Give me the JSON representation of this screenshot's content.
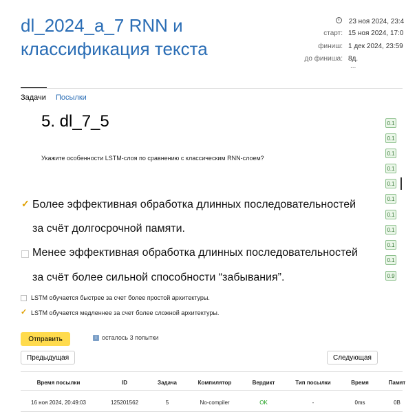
{
  "contest": {
    "title": "dl_2024_a_7 RNN и классификация текста",
    "time_now": "23 ноя 2024, 23:4",
    "start_label": "старт:",
    "start_value": "15 ноя 2024, 17:0",
    "finish_label": "финиш:",
    "finish_value": "1 дек 2024, 23:59",
    "until_label": "до финиша:",
    "until_value": "8д.",
    "more": "..."
  },
  "tabs": [
    {
      "label": "Задачи",
      "active": true
    },
    {
      "label": "Посылки",
      "active": false
    }
  ],
  "task": {
    "title": "5. dl_7_5",
    "question": "Укажите особенности LSTM-слоя по сравнению с классическим RNN-слоем?"
  },
  "options": [
    {
      "line1": "Более эффективная обработка длинных последовательностей",
      "line2": "за счёт долгосрочной памяти.",
      "checked": true
    },
    {
      "line1": "Менее эффективная обработка длинных последовательностей",
      "line2": "за счёт более сильной способности “забывания”.",
      "checked": false
    },
    {
      "line1": "LSTM обучается быстрее за счет более простой архитектуры.",
      "checked": false
    },
    {
      "line1": "LSTM обучается медленнее за счет более сложной архитектуры.",
      "checked": true
    }
  ],
  "scores": [
    "0.1",
    "0.1",
    "0.1",
    "0.1",
    "0.1",
    "0.1",
    "0.1",
    "0.1",
    "0.1",
    "0.1",
    "0.9"
  ],
  "actions": {
    "submit": "Отправить",
    "attempts": "осталось 3 попытки",
    "prev": "Предыдущая",
    "next": "Следующая"
  },
  "table": {
    "headers": [
      "Время посылки",
      "ID",
      "Задача",
      "Компилятор",
      "Вердикт",
      "Тип посылки",
      "Время",
      "Памят"
    ],
    "rows": [
      [
        "16 ноя 2024, 20:49:03",
        "125201562",
        "5",
        "No-compiler",
        "OK",
        "-",
        "0ms",
        "0B"
      ]
    ]
  },
  "colors": {
    "accent": "#2a6db5",
    "submit": "#ffdb4d",
    "ok": "#1a9e1a",
    "checkmark": "#e0a000"
  }
}
